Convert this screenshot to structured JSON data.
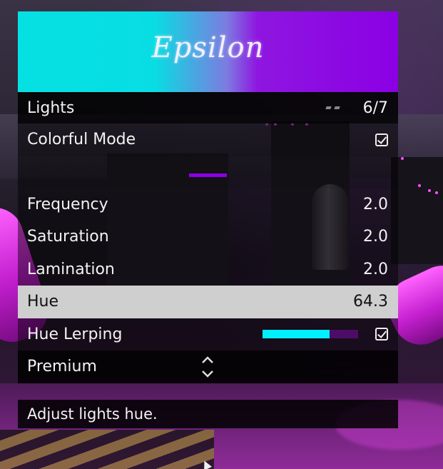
{
  "menu": {
    "title": "Epsilon",
    "banner_colors": {
      "left": "#05e1e3",
      "right": "#8b00e4"
    },
    "header": {
      "label": "Lights",
      "page": "6/7"
    },
    "items": [
      {
        "label": "Colorful Mode",
        "type": "checkbox",
        "checked": true
      },
      {
        "type": "separator",
        "accent": "#8b00e4"
      },
      {
        "label": "Frequency",
        "value": "2.0"
      },
      {
        "label": "Saturation",
        "value": "2.0"
      },
      {
        "label": "Lamination",
        "value": "2.0"
      },
      {
        "label": "Hue",
        "value": "64.3",
        "selected": true
      },
      {
        "label": "Hue Lerping",
        "type": "checkbox-progress",
        "checked": true,
        "progress": 0.7,
        "fill_color": "#00f0ff"
      },
      {
        "label": "Premium",
        "icon": "up-down-arrows-icon"
      }
    ],
    "description": "Adjust lights hue."
  }
}
